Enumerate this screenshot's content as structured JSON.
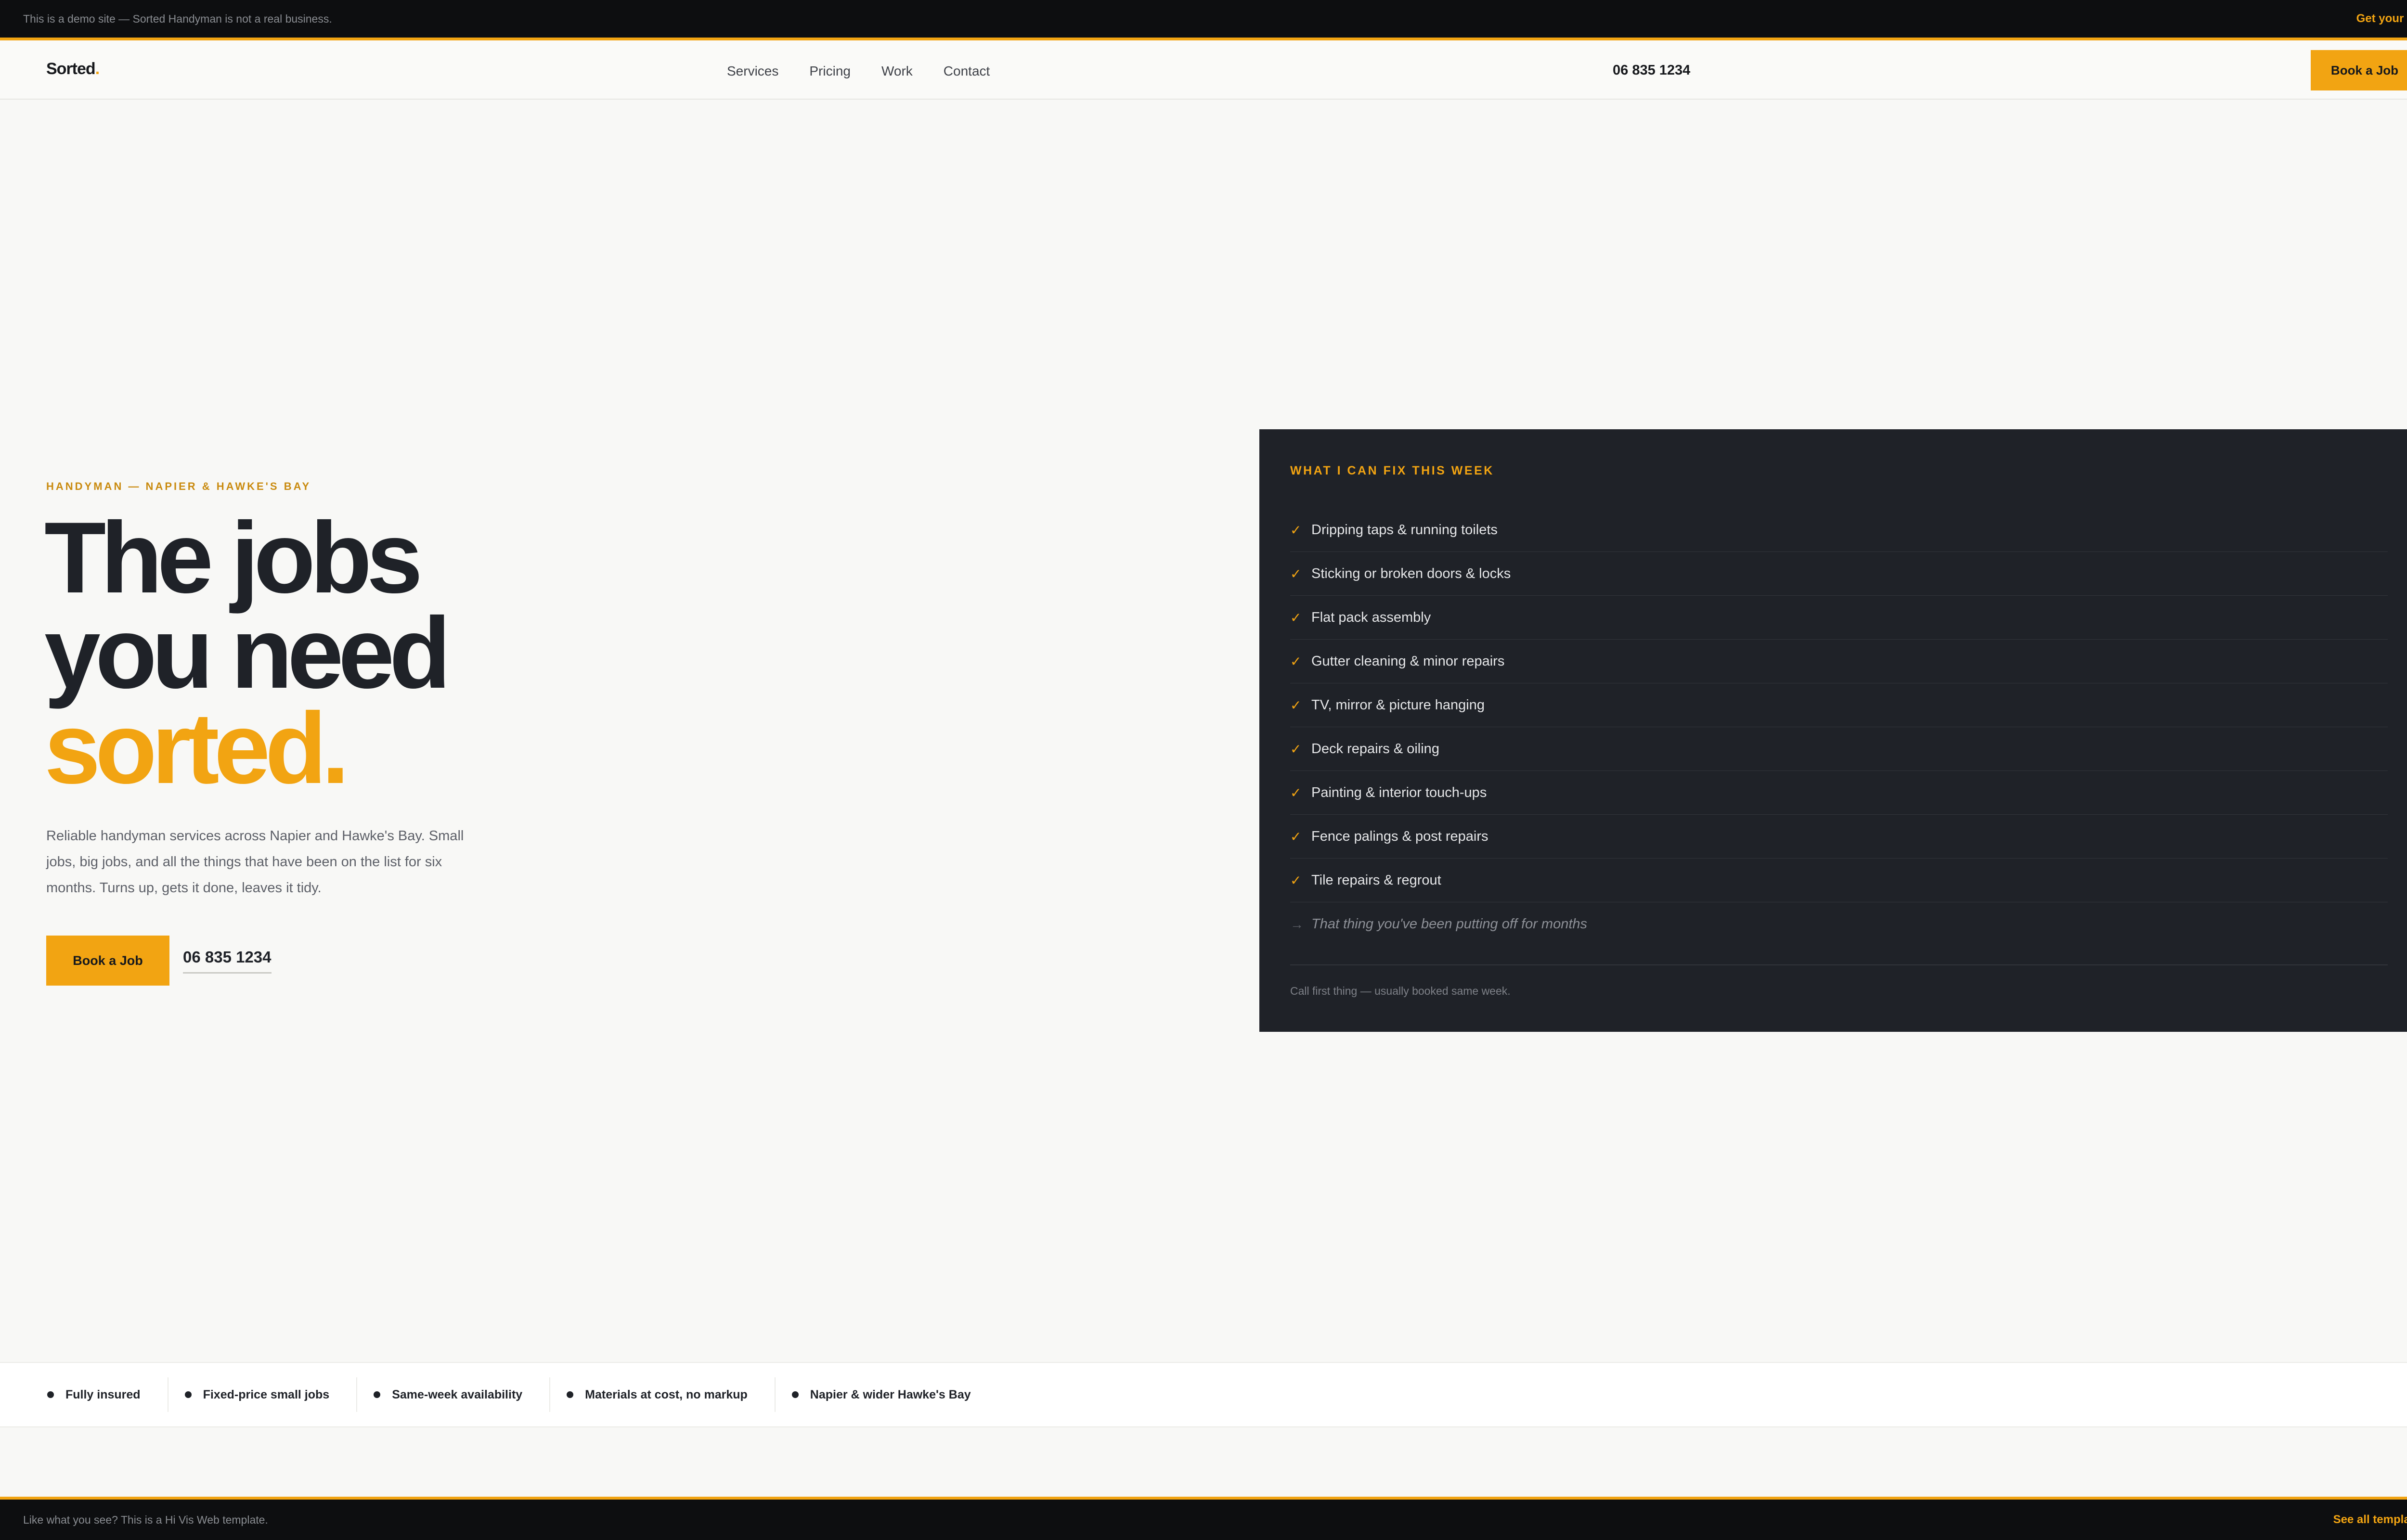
{
  "demo_bar": {
    "message": "This is a demo site — Sorted Handyman is not a real business.",
    "cta": "Get your site →"
  },
  "nav": {
    "logo": "Sorted",
    "logo_dot": ".",
    "links": [
      "Services",
      "Pricing",
      "Work",
      "Contact"
    ],
    "phone": "06 835 1234",
    "cta": "Book a Job"
  },
  "hero": {
    "eyebrow": "HANDYMAN — NAPIER & HAWKE'S BAY",
    "headline_line1": "The jobs",
    "headline_line2": "you need",
    "headline_accent": "sorted.",
    "lede": "Reliable handyman services across Napier and Hawke's Bay. Small jobs, big jobs, and all the things that have been on the list for six months. Turns up, gets it done, leaves it tidy.",
    "cta": "Book a Job",
    "phone": "06 835 1234"
  },
  "panel": {
    "title": "WHAT I CAN FIX THIS WEEK",
    "tick": "✓",
    "items": [
      "Dripping taps & running toilets",
      "Sticking or broken doors & locks",
      "Flat pack assembly",
      "Gutter cleaning & minor repairs",
      "TV, mirror & picture hanging",
      "Deck repairs & oiling",
      "Painting & interior touch-ups",
      "Fence palings & post repairs",
      "Tile repairs & regrout"
    ],
    "last_marker": "→",
    "last_item": "That thing you've been putting off for months",
    "note": "Call first thing — usually booked same week."
  },
  "trust": [
    "Fully insured",
    "Fixed-price small jobs",
    "Same-week availability",
    "Materials at cost, no markup",
    "Napier & wider Hawke's Bay"
  ],
  "footer_bar": {
    "message": "Like what you see? This is a Hi Vis Web template.",
    "cta": "See all templates →"
  },
  "colors": {
    "accent": "#f2a412",
    "dark": "#1f2228",
    "page_bg": "#f8f8f6"
  }
}
